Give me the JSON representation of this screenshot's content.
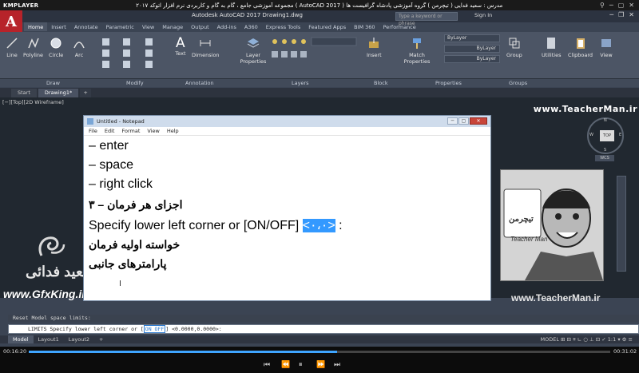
{
  "kmplayer": {
    "logo": "KMPLAYER",
    "title": "مجموعه آموزشی جامع ، گام به گام و کاربردی نرم افزار اتوکد ۲۰۱۷ ( AutoCAD 2017 ) مدرس : سعید فدایی ( تیچرمن ) گروه آموزشی پادشاه گرافیست ها",
    "controls": [
      "⚲",
      "─",
      "▢",
      "✕"
    ]
  },
  "acad": {
    "app_title": "Autodesk AutoCAD 2017    Drawing1.dwg",
    "search_placeholder": "Type a keyword or phrase",
    "sign_in": "Sign In",
    "tabs": [
      "Home",
      "Insert",
      "Annotate",
      "Parametric",
      "View",
      "Manage",
      "Output",
      "Add-ins",
      "A360",
      "Express Tools",
      "Featured Apps",
      "BIM 360",
      "Performance"
    ],
    "tools": {
      "line": "Line",
      "polyline": "Polyline",
      "circle": "Circle",
      "arc": "Arc",
      "text": "Text",
      "dimension": "Dimension",
      "layer_properties": "Layer Properties",
      "insert": "Insert",
      "match_properties": "Match Properties",
      "group": "Group",
      "utilities": "Utilities",
      "clipboard": "Clipboard",
      "view": "View"
    },
    "panels": {
      "draw": "Draw",
      "modify": "Modify",
      "annotation": "Annotation",
      "layers": "Layers",
      "block": "Block",
      "properties": "Properties",
      "groups": "Groups"
    },
    "bylayer": [
      "ByLayer",
      "ByLayer",
      "ByLayer"
    ],
    "doc_tabs": [
      "Start",
      "Drawing1*",
      "+"
    ],
    "view_label": "[−][Top][2D Wireframe]",
    "viewcube": {
      "top": "TOP",
      "n": "N",
      "s": "S",
      "e": "E",
      "w": "W",
      "wcs": "WCS"
    },
    "brand": "www.TeacherMan.ir",
    "command_history": "Reset Model space limits:",
    "command_prompt": "LIMITS Specify lower left corner or [",
    "command_on": "ON OFF",
    "command_tail": "] <0.0000,0.0000>:",
    "layout_tabs": [
      "Model",
      "Layout1",
      "Layout2",
      "+"
    ],
    "status": "MODEL  ⊞ ⊟ ⌗ ∟ ○ ⊥ ⊡ ✓ 1:1 ▾ ⚙ ≡"
  },
  "notepad": {
    "title": "Untitled - Notepad",
    "menu": [
      "File",
      "Edit",
      "Format",
      "View",
      "Help"
    ],
    "lines": [
      "– enter",
      "– space",
      "– right click",
      "اجزای هر فرمان – ۳",
      "Specify lower left corner or [ON/OFF]",
      "<۰،۰>",
      ":",
      "خواسته اولیه فرمان",
      "پارامترهای جانبی"
    ]
  },
  "watermark": {
    "logo_text": "سعید فدائی",
    "site": "www.GfxKing.ir",
    "avatar_brand": "تیچرمن",
    "avatar_sub": "Teacher Man",
    "avatar_site": "www.TeacherMan.ir"
  },
  "player": {
    "current_time": "00:16:20",
    "total_time": "00:31:02",
    "progress": 0.53,
    "controls": [
      "⏮",
      "⏪",
      "⏸",
      "⏩",
      "⏭"
    ]
  },
  "colors": {
    "accent": "#3fa5ff",
    "acad_red": "#b7232a",
    "highlight": "#3399ff"
  }
}
